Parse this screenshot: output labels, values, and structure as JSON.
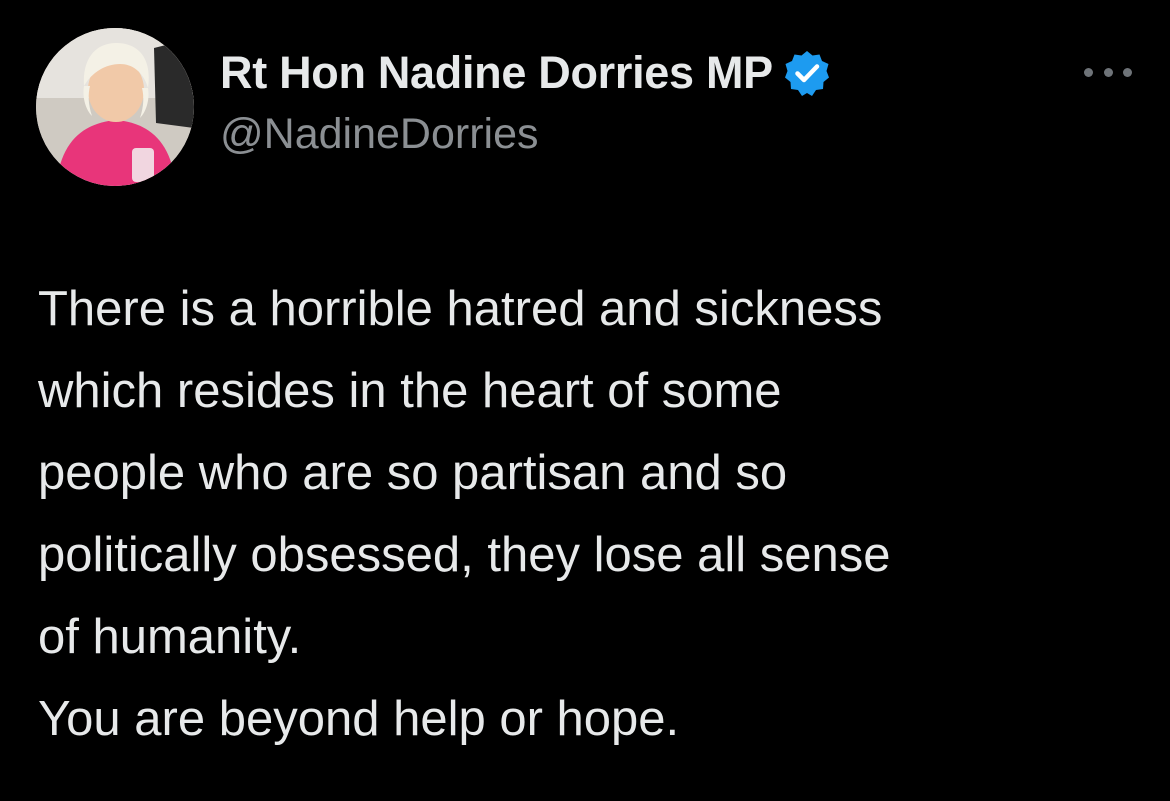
{
  "tweet": {
    "author": {
      "display_name": "Rt Hon Nadine Dorries MP",
      "handle": "@NadineDorries",
      "verified": true,
      "verified_color": "#1d9bf0"
    },
    "more_icon": "ellipsis-icon",
    "lines": [
      "There is a horrible hatred and sickness",
      "which resides in the heart of some",
      "people who are so partisan and so",
      "politically obsessed, they lose all sense",
      "of humanity.",
      "You are beyond help or hope."
    ]
  },
  "theme": {
    "background": "#000000",
    "text": "#e7e9ea",
    "secondary_text": "#8b8f93"
  }
}
